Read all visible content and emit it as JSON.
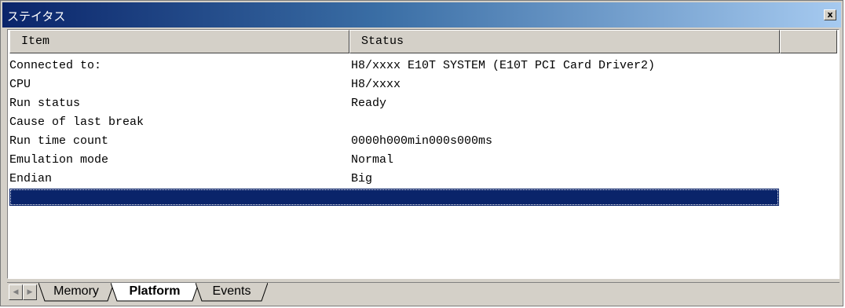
{
  "window": {
    "title": "ステイタス",
    "close_glyph": "x"
  },
  "table": {
    "columns": [
      "Item",
      "Status"
    ],
    "rows": [
      {
        "item": "Connected to:",
        "status": "H8/xxxx E10T SYSTEM (E10T PCI Card Driver2)"
      },
      {
        "item": "CPU",
        "status": "H8/xxxx"
      },
      {
        "item": "Run status",
        "status": "Ready"
      },
      {
        "item": "Cause of last break",
        "status": ""
      },
      {
        "item": "Run time count",
        "status": "0000h000min000s000ms"
      },
      {
        "item": "Emulation mode",
        "status": "Normal"
      },
      {
        "item": "Endian",
        "status": "Big"
      }
    ],
    "selected_row": "empty-selected-row"
  },
  "tabs": {
    "items": [
      {
        "label": "Memory",
        "active": false
      },
      {
        "label": "Platform",
        "active": true
      },
      {
        "label": "Events",
        "active": false
      }
    ],
    "scroll_left_glyph": "◀",
    "scroll_right_glyph": "▶"
  },
  "colors": {
    "title_gradient_start": "#0a246a",
    "title_gradient_end": "#a6caf0",
    "selection": "#0a246a",
    "face": "#d4d0c8"
  }
}
